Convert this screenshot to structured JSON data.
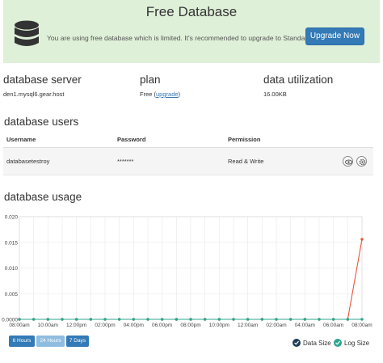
{
  "banner": {
    "title": "Free Database",
    "message": "You are using free database which is limited. It's recommended to upgrade to Standard.",
    "upgrade_label": "Upgrade Now",
    "icon": "database-icon"
  },
  "info": {
    "server": {
      "heading": "database server",
      "value": "den1.mysql6.gear.host"
    },
    "plan": {
      "heading": "plan",
      "value": "Free",
      "link_open": "(",
      "link": "upgrade",
      "link_close": ")"
    },
    "utilization": {
      "heading": "data utilization",
      "value": "16.00KB"
    }
  },
  "users": {
    "title": "database users",
    "columns": [
      "Username",
      "Password",
      "Permission"
    ],
    "rows": [
      {
        "username": "databasetestroy",
        "password": "*******",
        "permission": "Read & Write"
      }
    ]
  },
  "usage": {
    "title": "database usage",
    "ranges": [
      "6 Hours",
      "24 Hours",
      "7 Days"
    ],
    "legend": [
      "Data Size",
      "Log Size"
    ]
  },
  "colors": {
    "banner_bg": "#dff0d8",
    "primary": "#337ab7",
    "data_size": "#e6553a",
    "log_size": "#2ca58d"
  },
  "chart_data": {
    "type": "line",
    "ylim": [
      0,
      0.02
    ],
    "yticks": [
      "0.020",
      "0.015",
      "0.010",
      "0.005",
      "0.0000"
    ],
    "xticks": [
      "08:00am",
      "10:00am",
      "12:00pm",
      "02:00pm",
      "04:00pm",
      "06:00pm",
      "08:00pm",
      "10:00pm",
      "12:00am",
      "02:00am",
      "04:00am",
      "06:00am",
      "08:00am"
    ],
    "x_points": 25,
    "series": [
      {
        "name": "Data Size",
        "values": [
          0,
          0,
          0,
          0,
          0,
          0,
          0,
          0,
          0,
          0,
          0,
          0,
          0,
          0,
          0,
          0,
          0,
          0,
          0,
          0,
          0,
          0,
          0,
          0,
          0.0156
        ]
      },
      {
        "name": "Log Size",
        "values": [
          0,
          0,
          0,
          0,
          0,
          0,
          0,
          0,
          0,
          0,
          0,
          0,
          0,
          0,
          0,
          0,
          0,
          0,
          0,
          0,
          0,
          0,
          0,
          0,
          0
        ]
      }
    ]
  }
}
